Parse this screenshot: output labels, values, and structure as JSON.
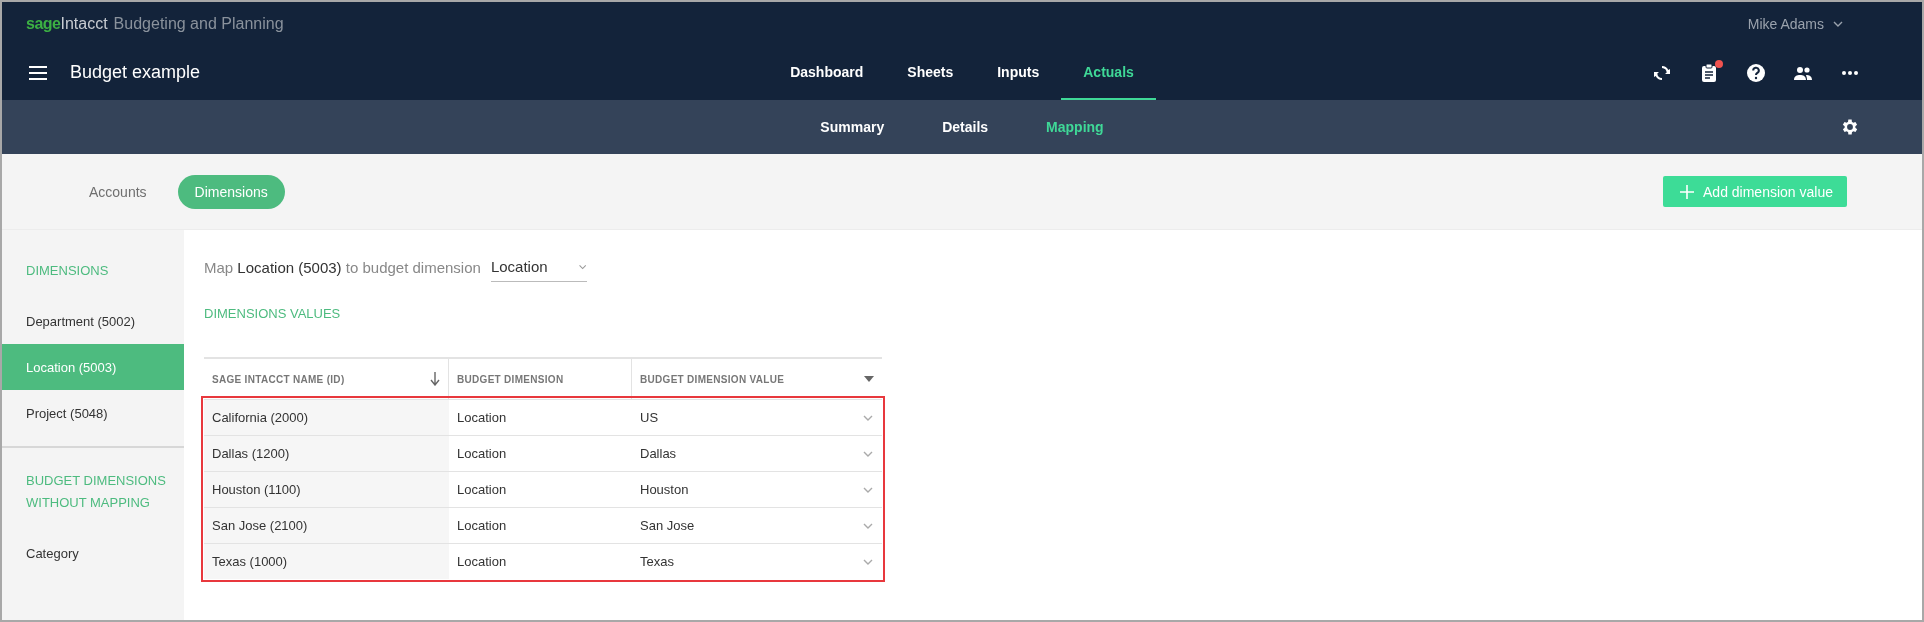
{
  "brand": {
    "mark": "sage",
    "product": "Intacct",
    "app": "Budgeting and Planning"
  },
  "user": {
    "name": "Mike Adams"
  },
  "title": "Budget example",
  "nav": [
    {
      "label": "Dashboard",
      "selected": false
    },
    {
      "label": "Sheets",
      "selected": false
    },
    {
      "label": "Inputs",
      "selected": false
    },
    {
      "label": "Actuals",
      "selected": true
    }
  ],
  "toolbar_icons": [
    {
      "kind": "sync",
      "badge": false
    },
    {
      "kind": "clipboard",
      "badge": true
    },
    {
      "kind": "help",
      "badge": false
    },
    {
      "kind": "people",
      "badge": false
    },
    {
      "kind": "more",
      "badge": false
    }
  ],
  "subnav": [
    {
      "label": "Summary",
      "selected": false
    },
    {
      "label": "Details",
      "selected": false
    },
    {
      "label": "Mapping",
      "selected": true
    }
  ],
  "segments": [
    {
      "label": "Accounts",
      "selected": false
    },
    {
      "label": "Dimensions",
      "selected": true
    }
  ],
  "add_button": "Add dimension value",
  "sidebar": {
    "sections": [
      {
        "heading": "DIMENSIONS",
        "items": [
          {
            "label": "Department (5002)",
            "selected": false
          },
          {
            "label": "Location (5003)",
            "selected": true
          },
          {
            "label": "Project (5048)",
            "selected": false
          }
        ]
      },
      {
        "heading": "BUDGET DIMENSIONS WITHOUT MAPPING",
        "items": [
          {
            "label": "Category",
            "selected": false
          }
        ]
      }
    ]
  },
  "map_line": {
    "prefix": "Map",
    "source": "Location (5003)",
    "middle": "to budget dimension",
    "value": "Location"
  },
  "values_heading": "DIMENSIONS VALUES",
  "table": {
    "highlighted": true,
    "columns": [
      {
        "label": "SAGE INTACCT NAME (ID)",
        "kind": "sort"
      },
      {
        "label": "BUDGET DIMENSION",
        "kind": "plain"
      },
      {
        "label": "BUDGET DIMENSION VALUE",
        "kind": "filter"
      }
    ],
    "rows": [
      [
        "California (2000)",
        "Location",
        "US"
      ],
      [
        "Dallas (1200)",
        "Location",
        "Dallas"
      ],
      [
        "Houston (1100)",
        "Location",
        "Houston"
      ],
      [
        "San Jose (2100)",
        "Location",
        "San Jose"
      ],
      [
        "Texas (1000)",
        "Location",
        "Texas"
      ]
    ]
  }
}
